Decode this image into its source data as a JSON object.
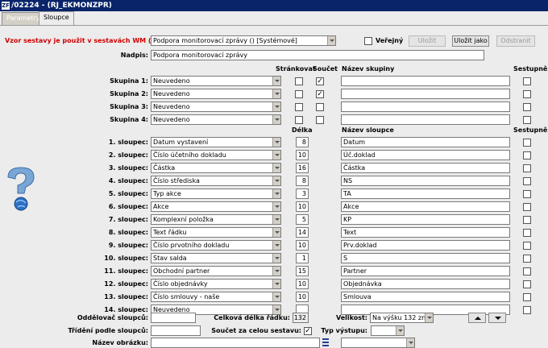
{
  "window": {
    "title": "/02224 - (RJ_EKMONZPR)",
    "app_icon": "ZF"
  },
  "tabs": [
    {
      "label": "Parametry"
    },
    {
      "label": "Sloupce"
    }
  ],
  "header": {
    "vzor_label": "Vzor sestavy je použit v sestavách WM (11).",
    "vzor_value": "Podpora monitorovací zprávy   ()   [Systémové]",
    "verejny_label": "Veřejný",
    "ulozit_label": "Uložit",
    "ulozit_jako_label": "Uložit jako",
    "odstranit_label": "Odstranit",
    "nadpis_label": "Nadpis:",
    "nadpis_value": "Podpora monitorovací zprávy"
  },
  "groups_header": {
    "strankovat": "Stránkovat",
    "soucet": "Součet",
    "nazev_skupiny": "Název skupiny",
    "sestupne": "Sestupně"
  },
  "groups": [
    {
      "label": "Skupina 1:",
      "value": "Neuvedeno",
      "strankovat": false,
      "soucet": true,
      "nazev": "",
      "sestupne": false
    },
    {
      "label": "Skupina 2:",
      "value": "Neuvedeno",
      "strankovat": false,
      "soucet": true,
      "nazev": "",
      "sestupne": false
    },
    {
      "label": "Skupina 3:",
      "value": "Neuvedeno",
      "strankovat": false,
      "soucet": false,
      "nazev": "",
      "sestupne": false
    },
    {
      "label": "Skupina 4:",
      "value": "Neuvedeno",
      "strankovat": false,
      "soucet": false,
      "nazev": "",
      "sestupne": false
    }
  ],
  "columns_header": {
    "delka": "Délka",
    "nazev_sloupce": "Název sloupce",
    "sestupne": "Sestupně"
  },
  "columns": [
    {
      "label": "1. sloupec:",
      "value": "Datum vystavení",
      "delka": "8",
      "nazev": "Datum"
    },
    {
      "label": "2. sloupec:",
      "value": "Číslo účetního dokladu",
      "delka": "10",
      "nazev": "Úč.doklad"
    },
    {
      "label": "3. sloupec:",
      "value": "Částka",
      "delka": "16",
      "nazev": "Částka"
    },
    {
      "label": "4. sloupec:",
      "value": "Číslo střediska",
      "delka": "8",
      "nazev": "NS"
    },
    {
      "label": "5. sloupec:",
      "value": "Typ akce",
      "delka": "3",
      "nazev": "TA"
    },
    {
      "label": "6. sloupec:",
      "value": "Akce",
      "delka": "10",
      "nazev": "Akce"
    },
    {
      "label": "7. sloupec:",
      "value": "Komplexní položka",
      "delka": "5",
      "nazev": "KP"
    },
    {
      "label": "8. sloupec:",
      "value": "Text řádku",
      "delka": "14",
      "nazev": "Text"
    },
    {
      "label": "9. sloupec:",
      "value": "Číslo prvotního dokladu",
      "delka": "10",
      "nazev": "Prv.doklad"
    },
    {
      "label": "10. sloupec:",
      "value": "Stav salda",
      "delka": "1",
      "nazev": "S"
    },
    {
      "label": "11. sloupec:",
      "value": "Obchodní partner",
      "delka": "15",
      "nazev": "Partner"
    },
    {
      "label": "12. sloupec:",
      "value": "Číslo objednávky",
      "delka": "10",
      "nazev": "Objednávka"
    },
    {
      "label": "13. sloupec:",
      "value": "Číslo smlouvy - naše",
      "delka": "10",
      "nazev": "Smlouva"
    },
    {
      "label": "14. sloupec:",
      "value": "Neuvedeno",
      "delka": "",
      "nazev": ""
    }
  ],
  "footer": {
    "oddelovac_label": "Oddělovač sloupců:",
    "oddelovac_value": "",
    "celkova_label": "Celková délka řádku:",
    "celkova_value": "132",
    "velikost_label": "Velikost:",
    "velikost_value": "Na výšku 132 zn.",
    "trideni_label": "Třídění podle sloupců:",
    "trideni_value": "",
    "soucet_label": "Součet za celou sestavu:",
    "soucet_checked": true,
    "typ_vystupu_label": "Typ výstupu:",
    "typ_vystupu_value": "",
    "nazev_obrazku_label": "Název obrázku:",
    "nazev_obrazku_value": "",
    "obrazek_combo_value": ""
  },
  "colors": {
    "title_bar": "#0a246a",
    "warning_text": "#d00000",
    "background": "#ececec"
  }
}
